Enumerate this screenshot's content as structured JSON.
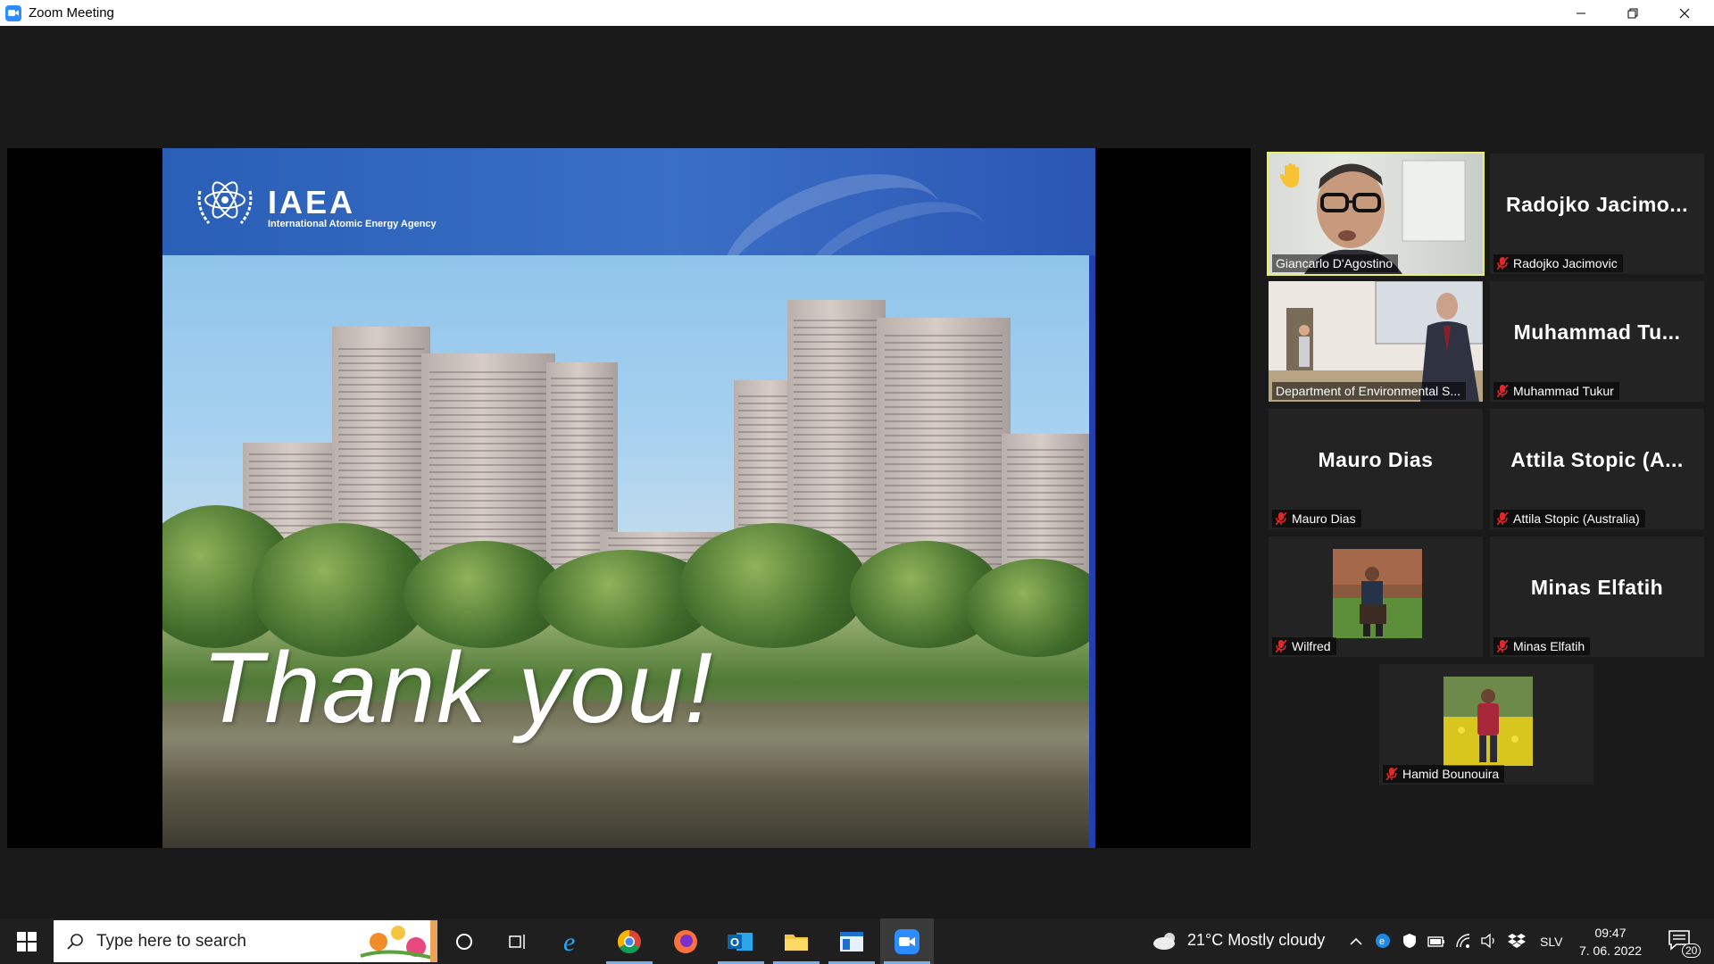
{
  "window": {
    "title": "Zoom Meeting"
  },
  "slide": {
    "logo_text": "IAEA",
    "logo_subtitle": "International Atomic Energy Agency",
    "closing_text": "Thank you!"
  },
  "participants": [
    {
      "display_name": "Giancarlo D'Agostino",
      "big_name": "",
      "has_video": true,
      "muted": false,
      "raised_hand": true,
      "active_speaker": true
    },
    {
      "display_name": "Radojko Jacimovic",
      "big_name": "Radojko Jacimo...",
      "has_video": false,
      "muted": true
    },
    {
      "display_name": "Department of Environmental S...",
      "big_name": "",
      "has_video": true,
      "muted": false
    },
    {
      "display_name": "Muhammad Tukur",
      "big_name": "Muhammad Tu...",
      "has_video": false,
      "muted": true
    },
    {
      "display_name": "Mauro Dias",
      "big_name": "Mauro Dias",
      "has_video": false,
      "muted": true
    },
    {
      "display_name": "Attila Stopic (Australia)",
      "big_name": "Attila Stopic (A...",
      "has_video": false,
      "muted": true
    },
    {
      "display_name": "Wilfred",
      "big_name": "",
      "has_video": false,
      "profile_photo": true,
      "muted": true
    },
    {
      "display_name": "Minas Elfatih",
      "big_name": "Minas Elfatih",
      "has_video": false,
      "muted": true
    },
    {
      "display_name": "Hamid Bounouira",
      "big_name": "",
      "has_video": false,
      "profile_photo": true,
      "muted": true
    }
  ],
  "taskbar": {
    "search_placeholder": "Type here to search",
    "weather": "21°C  Mostly cloudy",
    "language": "SLV",
    "time": "09:47",
    "date": "7. 06. 2022",
    "notification_count": "20"
  },
  "colors": {
    "zoom_blue": "#2d8cff",
    "active_speaker_border": "#e8f06a",
    "muted_red": "#e02828",
    "tile_bg": "#232323"
  }
}
